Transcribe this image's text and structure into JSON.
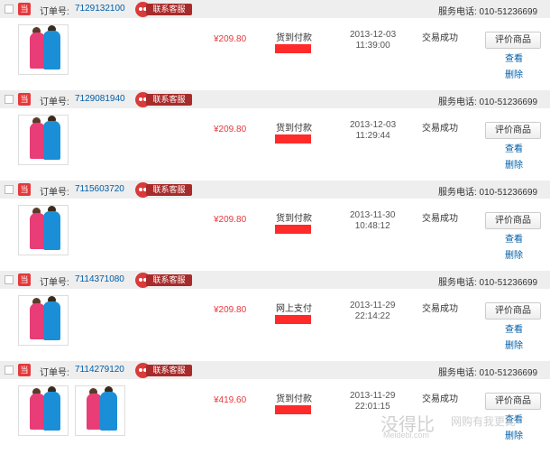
{
  "labels": {
    "order_no": "订单号:",
    "contact": "联系客服",
    "phone": "服务电话: 010-51236699",
    "shop_icon": "当",
    "review": "评价商品",
    "view": "查看",
    "delete": "删除"
  },
  "orders": [
    {
      "number": "7129132100",
      "price": "¥209.80",
      "payment": "货到付款",
      "date": "2013-12-03",
      "time": "11:39:00",
      "status": "交易成功",
      "thumbs": 1
    },
    {
      "number": "7129081940",
      "price": "¥209.80",
      "payment": "货到付款",
      "date": "2013-12-03",
      "time": "11:29:44",
      "status": "交易成功",
      "thumbs": 1
    },
    {
      "number": "7115603720",
      "price": "¥209.80",
      "payment": "货到付款",
      "date": "2013-11-30",
      "time": "10:48:12",
      "status": "交易成功",
      "thumbs": 1
    },
    {
      "number": "7114371080",
      "price": "¥209.80",
      "payment": "网上支付",
      "date": "2013-11-29",
      "time": "22:14:22",
      "status": "交易成功",
      "thumbs": 1
    },
    {
      "number": "7114279120",
      "price": "¥419.60",
      "payment": "货到付款",
      "date": "2013-11-29",
      "time": "22:01:15",
      "status": "交易成功",
      "thumbs": 2
    }
  ],
  "watermark": {
    "main": "没得比",
    "site": "Meidebi.com",
    "slogan": "网购有我更比"
  },
  "colors": {
    "price": "#e4393c",
    "link": "#005ea7",
    "redaction": "#ff2a2a"
  }
}
